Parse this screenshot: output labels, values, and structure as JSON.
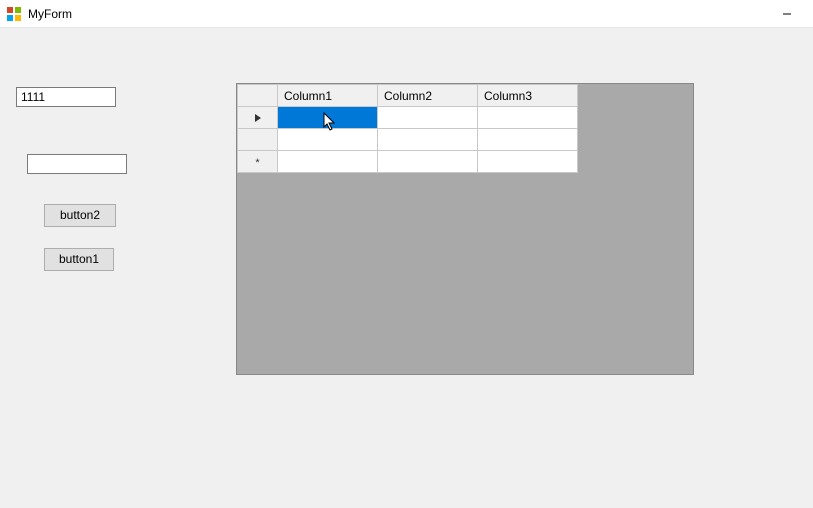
{
  "window": {
    "title": "MyForm"
  },
  "inputs": {
    "textbox1_value": "1111",
    "textbox2_value": ""
  },
  "buttons": {
    "button2_label": "button2",
    "button1_label": "button1"
  },
  "grid": {
    "columns": [
      "Column1",
      "Column2",
      "Column3"
    ],
    "rows": [
      {
        "indicator": "current",
        "cells": [
          "",
          "",
          ""
        ],
        "selected_col": 0
      },
      {
        "indicator": "",
        "cells": [
          "",
          "",
          ""
        ]
      },
      {
        "indicator": "new",
        "cells": [
          "",
          "",
          ""
        ]
      }
    ]
  },
  "colors": {
    "selection": "#0078d7",
    "form_bg": "#f0f0f0",
    "grid_bg": "#a9a9a9"
  }
}
